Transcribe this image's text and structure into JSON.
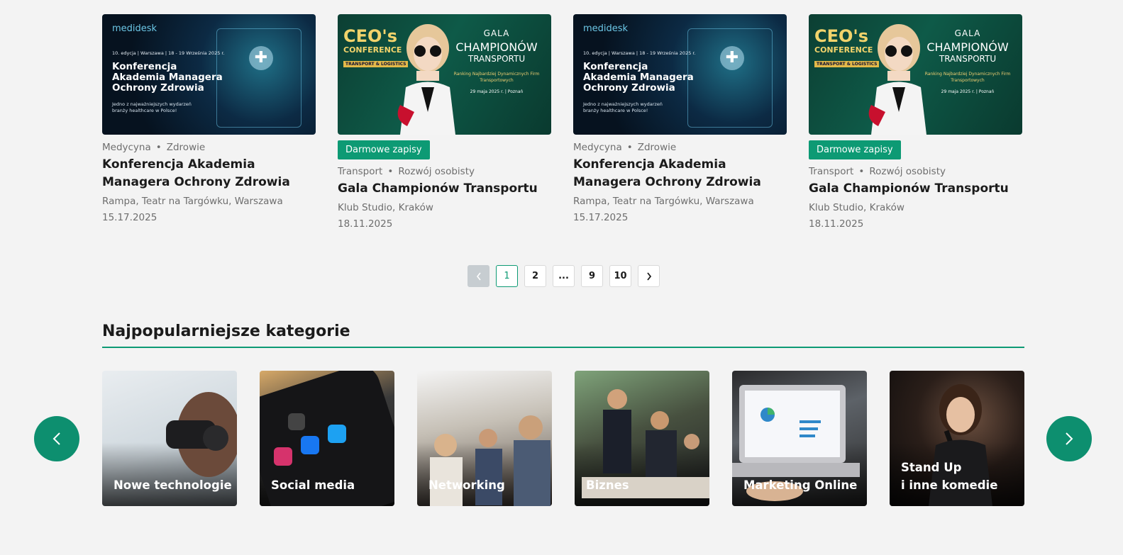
{
  "events": [
    {
      "image": "medidesk",
      "badge": "",
      "tags": [
        "Medycyna",
        "Zdrowie"
      ],
      "title": "Konferencja Akademia Managera Ochrony Zdrowia",
      "location": "Rampa, Teatr na Targówku, Warszawa",
      "date": "15.17.2025",
      "banner": {
        "logo": "medidesk",
        "line": "10. edycja | Warszawa | 18 - 19 Września 2025 r.",
        "headline": "Konferencja Akademia Managera Ochrony Zdrowia",
        "sub": "Jedno z najważniejszych wydarzeń branży healthcare w Polsce!"
      }
    },
    {
      "image": "gala",
      "badge": "Darmowe zapisy",
      "tags": [
        "Transport",
        "Rozwój osobisty"
      ],
      "title": "Gala Championów Transportu",
      "location": "Klub Studio, Kraków",
      "date": "18.11.2025",
      "banner": {
        "ceo": "CEO's",
        "conference": "CONFERENCE",
        "tl": "TRANSPORT & LOGISTICS",
        "gala": "GALA",
        "champ": "CHAMPIONÓW",
        "trans": "TRANSPORTU",
        "ranking": "Ranking Najbardziej Dynamicznych Firm Transportowych",
        "when": "29 maja 2025 r. | Poznań"
      }
    },
    {
      "image": "medidesk",
      "badge": "",
      "tags": [
        "Medycyna",
        "Zdrowie"
      ],
      "title": "Konferencja Akademia Managera Ochrony Zdrowia",
      "location": "Rampa, Teatr na Targówku, Warszawa",
      "date": "15.17.2025",
      "banner": {
        "logo": "medidesk",
        "line": "10. edycja | Warszawa | 18 - 19 Września 2025 r.",
        "headline": "Konferencja Akademia Managera Ochrony Zdrowia",
        "sub": "Jedno z najważniejszych wydarzeń branży healthcare w Polsce!"
      }
    },
    {
      "image": "gala",
      "badge": "Darmowe zapisy",
      "tags": [
        "Transport",
        "Rozwój osobisty"
      ],
      "title": "Gala Championów Transportu",
      "location": "Klub Studio, Kraków",
      "date": "18.11.2025",
      "banner": {
        "ceo": "CEO's",
        "conference": "CONFERENCE",
        "tl": "TRANSPORT & LOGISTICS",
        "gala": "GALA",
        "champ": "CHAMPIONÓW",
        "trans": "TRANSPORTU",
        "ranking": "Ranking Najbardziej Dynamicznych Firm Transportowych",
        "when": "29 maja 2025 r. | Poznań"
      }
    }
  ],
  "pagination": {
    "prev_icon": "chevron-left-icon",
    "next_icon": "chevron-right-icon",
    "pages": [
      "1",
      "2",
      "...",
      "9",
      "10"
    ],
    "active": "1"
  },
  "categories": {
    "heading": "Najpopularniejsze kategorie",
    "items": [
      {
        "label": "Nowe technologie",
        "scene": "vr-headset"
      },
      {
        "label": "Social media",
        "scene": "phone-apps"
      },
      {
        "label": "Networking",
        "scene": "people-talking"
      },
      {
        "label": "Biznes",
        "scene": "business-meeting"
      },
      {
        "label": "Marketing Online",
        "scene": "laptop-analytics"
      },
      {
        "label": "Stand Up\ni inne komedie",
        "scene": "comedian-microphone"
      }
    ],
    "prev_icon": "chevron-left-icon",
    "next_icon": "chevron-right-icon"
  },
  "colors": {
    "accent": "#0d9a74",
    "background": "#f3f3f3"
  }
}
